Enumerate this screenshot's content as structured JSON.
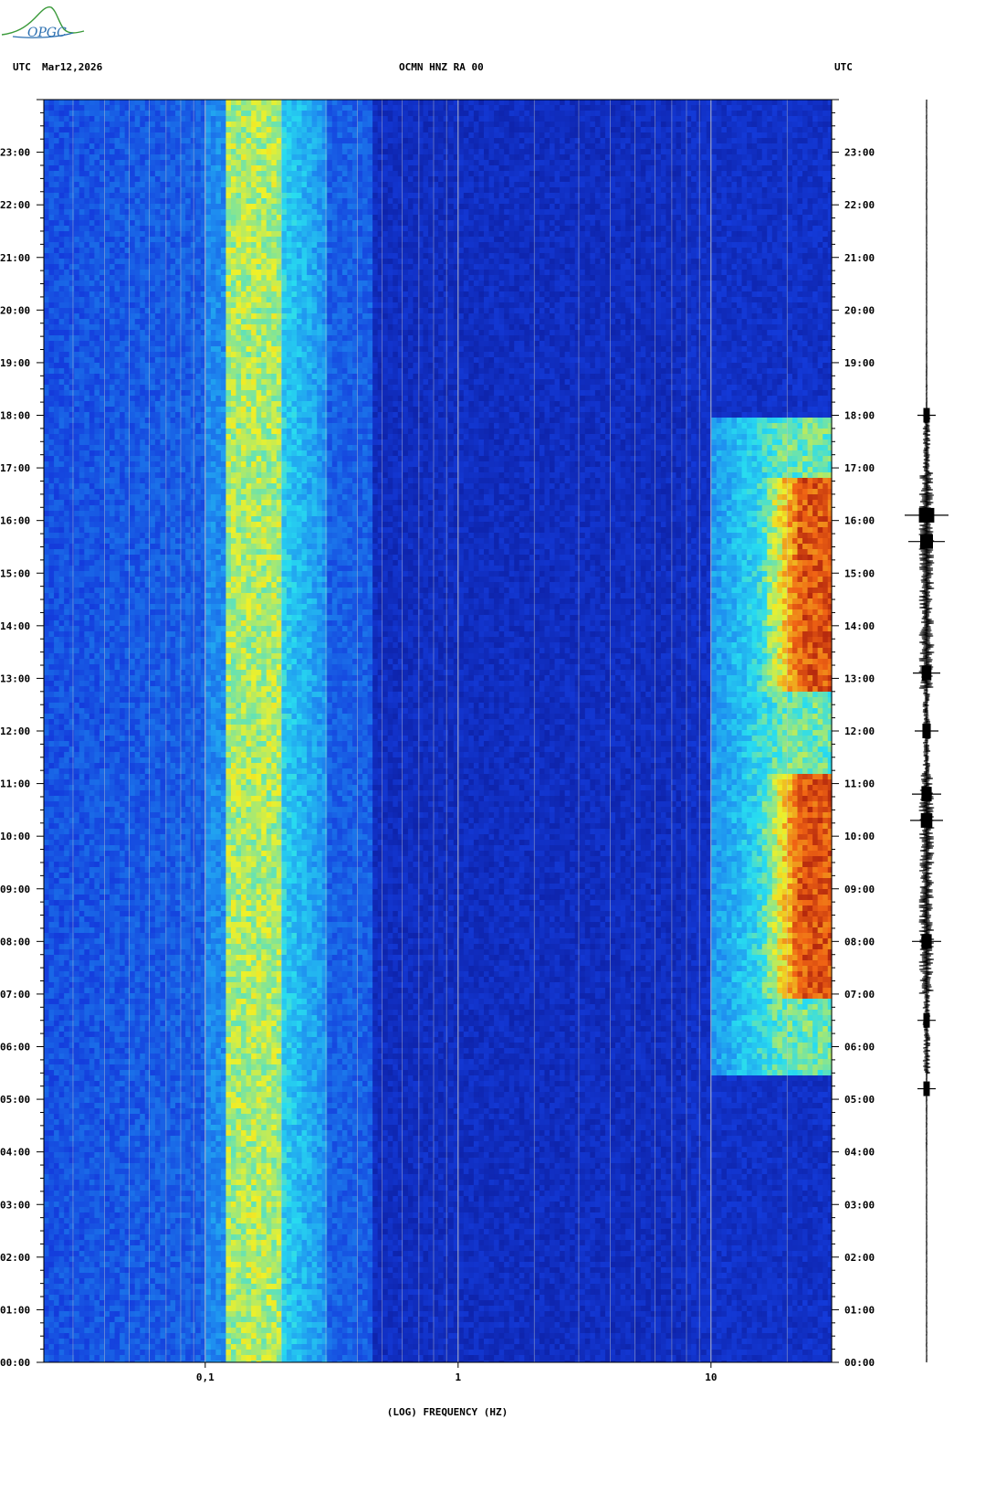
{
  "header": {
    "left_timezone": "UTC",
    "date": "Mar12,2026",
    "station_channel": "OCMN HNZ RA 00",
    "right_timezone": "UTC"
  },
  "logo": {
    "text": "OPGC"
  },
  "colors": {
    "background_low": "#0a14a0",
    "cmap_low": "#1438d8",
    "cmap_mid": "#28d8f0",
    "cmap_high": "#f0f028",
    "cmap_peak": "#a00a0a",
    "gridline": "#c8c8c8"
  },
  "chart_data": {
    "type": "heatmap",
    "title": "OCMN HNZ RA 00",
    "xlabel": "(LOG) FREQUENCY (HZ)",
    "x_scale": "log",
    "xlim": [
      0.023,
      30
    ],
    "x_ticks": [
      {
        "value": 0.1,
        "label": "0,1"
      },
      {
        "value": 1,
        "label": "1"
      },
      {
        "value": 10,
        "label": "10"
      }
    ],
    "ylabel": "UTC",
    "ylim_hours": [
      0,
      24
    ],
    "y_ticks": [
      "00:00",
      "01:00",
      "02:00",
      "03:00",
      "04:00",
      "05:00",
      "06:00",
      "07:00",
      "08:00",
      "09:00",
      "10:00",
      "11:00",
      "12:00",
      "13:00",
      "14:00",
      "15:00",
      "16:00",
      "17:00",
      "18:00",
      "19:00",
      "20:00",
      "21:00",
      "22:00",
      "23:00"
    ],
    "microseism_band_hz": [
      0.12,
      0.2
    ],
    "high_frequency_activity": [
      {
        "start_hour": 7.0,
        "end_hour": 11.2,
        "min_freq_hz": 15,
        "max_freq_hz": 30
      },
      {
        "start_hour": 12.8,
        "end_hour": 16.9,
        "min_freq_hz": 15,
        "max_freq_hz": 30
      },
      {
        "start_hour": 5.5,
        "end_hour": 18.0,
        "min_freq_hz": 10,
        "max_freq_hz": 30
      }
    ],
    "seismogram": {
      "type": "line",
      "bursts": [
        {
          "hour": 16.1,
          "amplitude": 1.0
        },
        {
          "hour": 15.6,
          "amplitude": 0.8
        },
        {
          "hour": 13.1,
          "amplitude": 0.55
        },
        {
          "hour": 12.0,
          "amplitude": 0.45
        },
        {
          "hour": 10.8,
          "amplitude": 0.6
        },
        {
          "hour": 10.3,
          "amplitude": 0.7
        },
        {
          "hour": 8.0,
          "amplitude": 0.6
        },
        {
          "hour": 6.5,
          "amplitude": 0.3
        },
        {
          "hour": 5.2,
          "amplitude": 0.3
        },
        {
          "hour": 18.0,
          "amplitude": 0.3
        }
      ]
    }
  }
}
